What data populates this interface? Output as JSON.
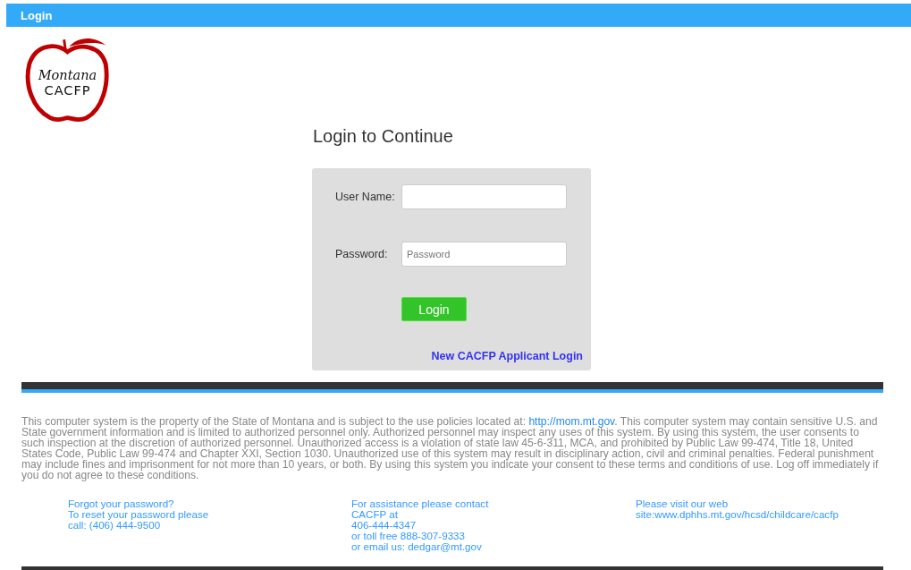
{
  "header": {
    "title": "Login"
  },
  "logo": {
    "script_text": "Montana",
    "name": "CACFP"
  },
  "heading": "Login to Continue",
  "form": {
    "fields": [
      {
        "label": "User Name:"
      },
      {
        "label": "Password:",
        "placeholder": "Password"
      }
    ],
    "submit": "Login",
    "applicant_link": "New CACFP Applicant Login"
  },
  "disclaimer": {
    "before": "This computer system is the property of the State of Montana and is subject to the use policies located at: ",
    "link": "http://mom.mt.gov",
    "after": ". This computer system may contain sensitive U.S. and State government information and is limited to authorized personnel only. Authorized personnel may inspect any uses of this system. By using this system, the user consents to such inspection at the discretion of authorized personnel. Unauthorized access is a violation of state law 45-6-311, MCA, and prohibited by Public Law 99-474, Title 18, United States Code, Public Law 99-474 and Chapter XXI, Section 1030. Unauthorized use of this system may result in disciplinary action, civil and criminal penalties. Federal punishment may include fines and imprisonment for not more than 10 years, or both. By using this system you indicate your consent to these terms and conditions of use. Log off immediately if you do not agree to these conditions."
  },
  "footer_columns": [
    {
      "lines": [
        "Forgot your password?",
        "To reset your password please",
        "call: (406) 444-9500"
      ]
    },
    {
      "lines": [
        "For assistance please contact",
        "CACFP at",
        "406-444-4347",
        "or toll free 888-307-9333",
        "or email us: dedgar@mt.gov"
      ]
    },
    {
      "lines": [
        "Please visit our web",
        "site:www.dphhs.mt.gov/hcsd/childcare/cacfp"
      ]
    }
  ]
}
